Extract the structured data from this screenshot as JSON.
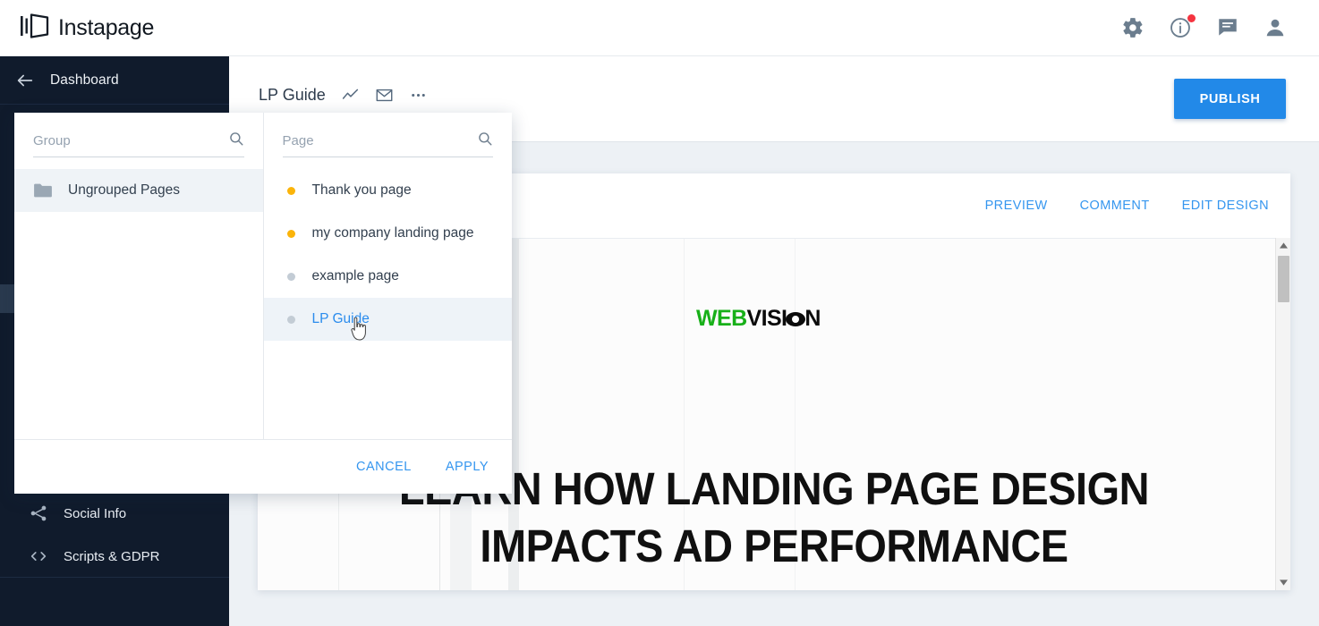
{
  "topbar": {
    "brand": "Instapage",
    "icons": [
      {
        "name": "gear-icon",
        "label": "Settings"
      },
      {
        "name": "info-icon",
        "label": "Help",
        "badge": true
      },
      {
        "name": "chat-icon",
        "label": "Messages"
      },
      {
        "name": "person-icon",
        "label": "Account"
      }
    ]
  },
  "sidebar": {
    "dashboard_label": "Dashboard",
    "back_icon": "arrow-left-icon",
    "items": [
      {
        "label": "Social Info",
        "icon": "share-icon"
      },
      {
        "label": "Scripts & GDPR",
        "icon": "code-icon"
      }
    ]
  },
  "editor": {
    "page_title": "LP Guide",
    "icons": [
      {
        "name": "analytics-icon"
      },
      {
        "name": "mail-icon"
      },
      {
        "name": "more-icon"
      }
    ],
    "publish_label": "PUBLISH"
  },
  "preview": {
    "actions": [
      "PREVIEW",
      "COMMENT",
      "EDIT DESIGN"
    ],
    "logo": {
      "first": "WEB",
      "second": "VISI",
      "third": "N"
    },
    "headline_line1": "LEARN HOW LANDING PAGE DESIGN",
    "headline_line2": "IMPACTS AD PERFORMANCE",
    "scrollbar": {
      "up": "▲",
      "down": "▼"
    }
  },
  "picker": {
    "group": {
      "placeholder": "Group",
      "search_icon": "search-icon",
      "rows": [
        {
          "label": "Ungrouped Pages",
          "icon": "folder-icon",
          "selected": true
        }
      ]
    },
    "page": {
      "placeholder": "Page",
      "search_icon": "search-icon",
      "rows": [
        {
          "label": "Thank you page",
          "dot": "#fbb40a",
          "selected": false
        },
        {
          "label": "my company landing page",
          "dot": "#fbb40a",
          "selected": false
        },
        {
          "label": "example page",
          "dot": "#c3ccd5",
          "selected": false
        },
        {
          "label": "LP Guide",
          "dot": "#c3ccd5",
          "selected": true
        }
      ]
    },
    "footer": {
      "cancel": "CANCEL",
      "apply": "APPLY"
    }
  },
  "colors": {
    "accent_blue": "#2289e8",
    "link_blue": "#3596ef",
    "sidebar_dark": "#101b2c",
    "badge_red": "#f5333f",
    "dot_orange": "#fbb40a",
    "dot_grey": "#c3ccd5",
    "logo_green": "#18b019"
  }
}
